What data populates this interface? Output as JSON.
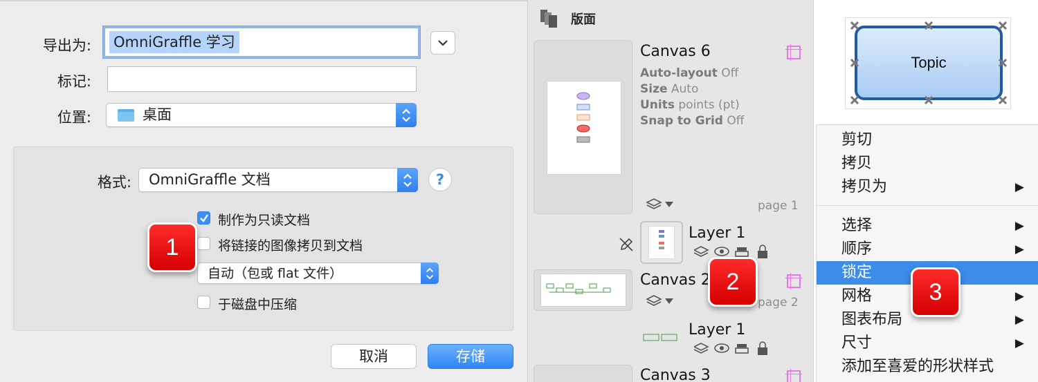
{
  "save_dialog": {
    "export_as_label": "导出为:",
    "export_as_value": "OmniGraffle 学习",
    "tags_label": "标记:",
    "tags_value": "",
    "location_label": "位置:",
    "location_value": "桌面",
    "format_label": "格式:",
    "format_value": "OmniGraffle 文档",
    "help_label": "?",
    "options": [
      {
        "label": "制作为只读文档",
        "checked": true
      },
      {
        "label": "将链接的图像拷贝到文档",
        "checked": false
      },
      {
        "label": "于磁盘中压缩",
        "checked": false
      }
    ],
    "image_mode_value": "自动（包或 flat 文件）",
    "cancel_label": "取消",
    "save_label": "存储"
  },
  "badges": [
    "1",
    "2",
    "3"
  ],
  "canvases_panel": {
    "header": "版面",
    "canvases": [
      {
        "title": "Canvas 6",
        "properties": [
          {
            "key": "Auto-layout",
            "value": "Off"
          },
          {
            "key": "Size",
            "value": "Auto"
          },
          {
            "key": "Units",
            "value": "points (pt)"
          },
          {
            "key": "Snap to Grid",
            "value": "Off"
          }
        ],
        "page": "page 1",
        "layer": "Layer 1"
      },
      {
        "title": "Canvas 2",
        "page": "page 2",
        "layer": "Layer 1"
      },
      {
        "title": "Canvas 3"
      }
    ]
  },
  "context_menu": {
    "topic_label": "Topic",
    "items": [
      {
        "label": "剪切",
        "submenu": false
      },
      {
        "label": "拷贝",
        "submenu": false
      },
      {
        "label": "拷贝为",
        "submenu": true
      },
      {
        "label": "选择",
        "submenu": true
      },
      {
        "label": "顺序",
        "submenu": true
      },
      {
        "label": "锁定",
        "submenu": false,
        "highlighted": true
      },
      {
        "label": "网格",
        "submenu": true
      },
      {
        "label": "图表布局",
        "submenu": true
      },
      {
        "label": "尺寸",
        "submenu": true
      },
      {
        "label": "添加至喜爱的形状样式",
        "submenu": false
      }
    ],
    "arrow_glyph": "▶"
  },
  "colors": {
    "accent": "#3d8ce8",
    "badge": "#e00000",
    "selection": "#b4d4fb"
  }
}
